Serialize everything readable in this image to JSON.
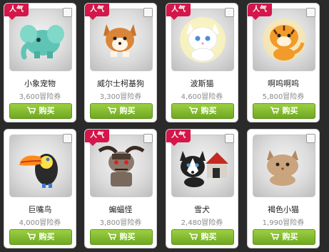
{
  "colors": {
    "hot_badge": "#d4164a",
    "buy_button": "#7fb72b",
    "page_bg": "#2a2a2a"
  },
  "buy_label": "购买",
  "hot_label": "人气",
  "pets": [
    {
      "name": "小象宠物",
      "price": "3,600冒险券",
      "hot": true,
      "icon": "elephant-icon"
    },
    {
      "name": "威尔士柯基狗",
      "price": "3,300冒险券",
      "hot": true,
      "icon": "corgi-icon"
    },
    {
      "name": "波斯猫",
      "price": "4,600冒险券",
      "hot": true,
      "icon": "persian-cat-icon"
    },
    {
      "name": "啊呜啊呜",
      "price": "5,800冒险券",
      "hot": true,
      "icon": "tiger-icon"
    },
    {
      "name": "巨嘴鸟",
      "price": "4,000冒险券",
      "hot": false,
      "icon": "toucan-icon"
    },
    {
      "name": "蝙蝠怪",
      "price": "3,800冒险券",
      "hot": true,
      "icon": "bat-monster-icon"
    },
    {
      "name": "雪犬",
      "price": "2,480冒险券",
      "hot": true,
      "icon": "husky-icon"
    },
    {
      "name": "褐色小猫",
      "price": "1,990冒险券",
      "hot": false,
      "icon": "brown-kitten-icon"
    }
  ]
}
